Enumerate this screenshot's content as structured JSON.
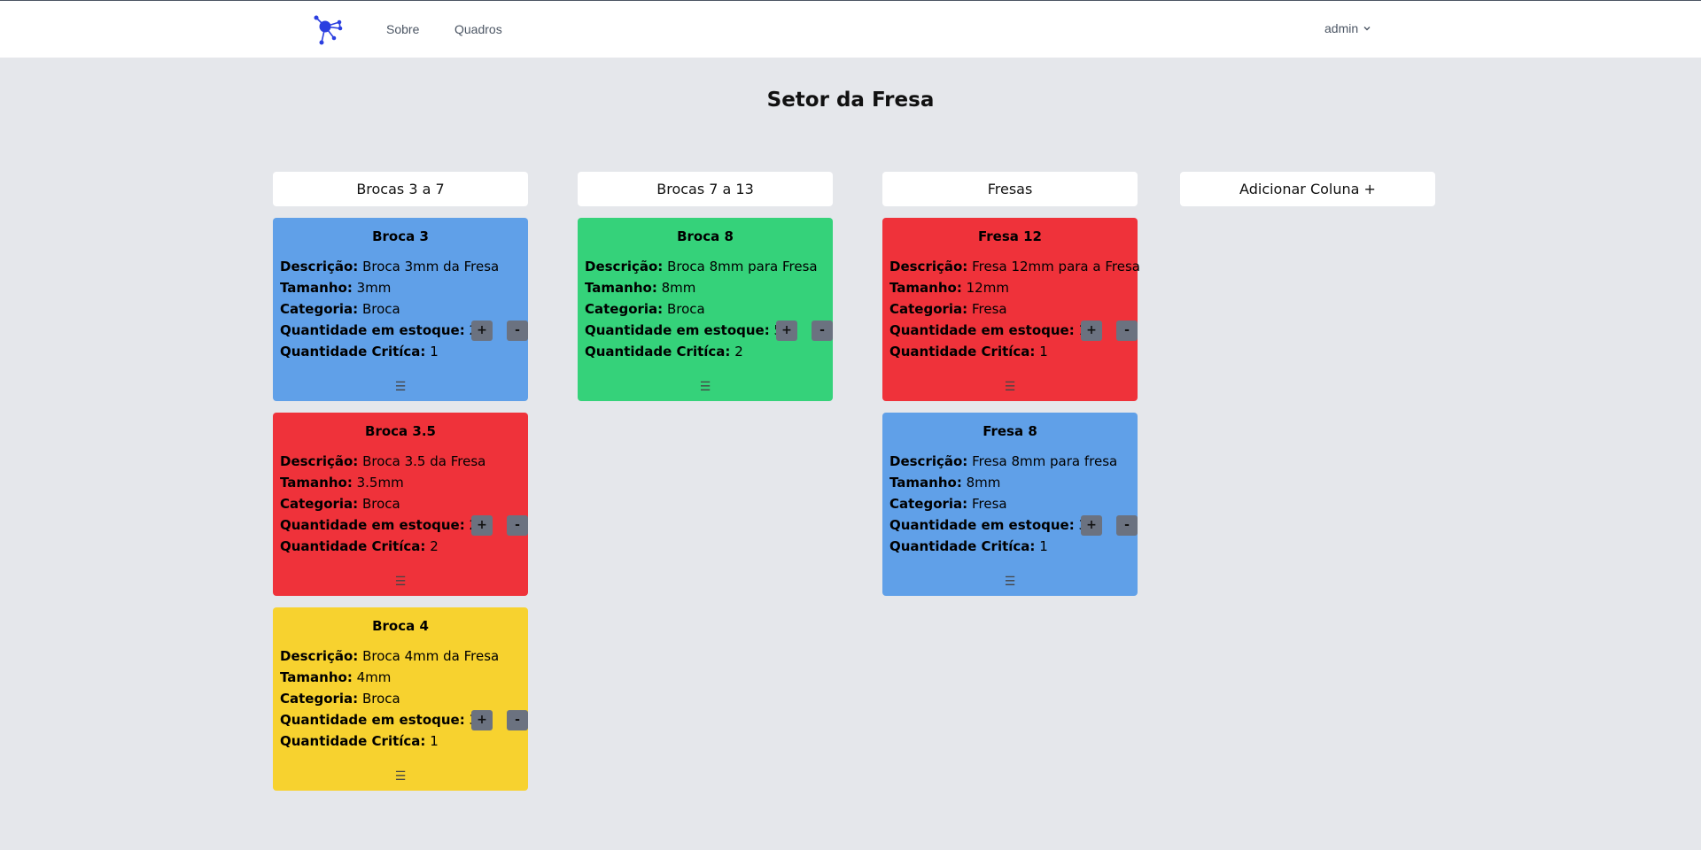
{
  "nav": {
    "about": "Sobre",
    "boards": "Quadros",
    "user": "admin"
  },
  "board": {
    "title": "Setor da Fresa"
  },
  "columns": [
    {
      "title": "Brocas 3 a 7"
    },
    {
      "title": "Brocas 7 a 13"
    },
    {
      "title": "Fresas"
    }
  ],
  "add_column": "Adicionar Coluna +",
  "labels": {
    "description": "Descrição:",
    "size": "Tamanho:",
    "category": "Categoria:",
    "stock": "Quantidade em estoque:",
    "critical": "Quantidade Critíca:",
    "plus": "+",
    "minus": "-",
    "drag": "☰"
  },
  "cards": [
    {
      "title": "Broca 3",
      "description": "Broca 3mm da Fresa",
      "size": "3mm",
      "category": "Broca",
      "stock": "2",
      "critical": "1",
      "color": "#60a0e8"
    },
    {
      "title": "Broca 3.5",
      "description": "Broca 3.5 da Fresa",
      "size": "3.5mm",
      "category": "Broca",
      "stock": "2",
      "critical": "2",
      "color": "#ef323a"
    },
    {
      "title": "Broca 4",
      "description": "Broca 4mm da Fresa",
      "size": "4mm",
      "category": "Broca",
      "stock": "3",
      "critical": "1",
      "color": "#f7d22f"
    },
    {
      "title": "Broca 8",
      "description": "Broca 8mm para Fresa",
      "size": "8mm",
      "category": "Broca",
      "stock": "5",
      "critical": "2",
      "color": "#35d27a"
    },
    {
      "title": "Fresa 12",
      "description": "Fresa 12mm para a Fresa",
      "size": "12mm",
      "category": "Fresa",
      "stock": "1",
      "critical": "1",
      "color": "#ef323a"
    },
    {
      "title": "Fresa 8",
      "description": "Fresa 8mm para fresa",
      "size": "8mm",
      "category": "Fresa",
      "stock": "3",
      "critical": "1",
      "color": "#60a0e8"
    }
  ],
  "icons": {
    "logo": "network-logo-icon",
    "chevron": "chevron-down-icon"
  }
}
